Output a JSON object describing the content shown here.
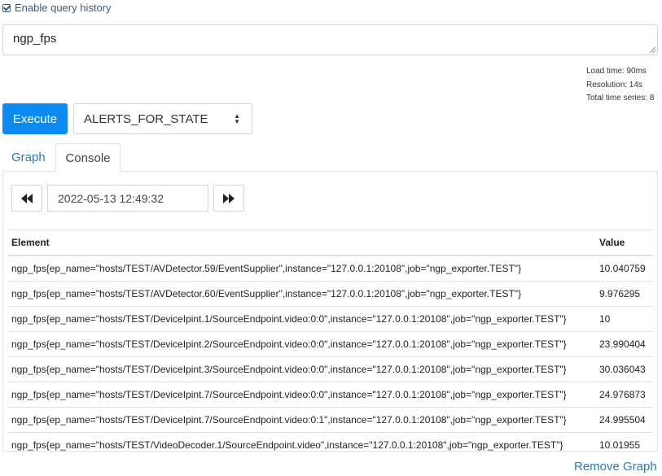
{
  "query_history": {
    "label": "Enable query history",
    "checked": true
  },
  "expression": "ngp_fps",
  "stats": {
    "load_time": "Load time: 90ms",
    "resolution": "Resolution: 14s",
    "total_series": "Total time series: 8"
  },
  "execute_label": "Execute",
  "metric_select": {
    "selected": "ALERTS_FOR_STATE"
  },
  "tabs": {
    "graph": "Graph",
    "console": "Console",
    "active": "console"
  },
  "console": {
    "eval_time": "2022-05-13 12:49:32",
    "columns": [
      "Element",
      "Value"
    ],
    "rows": [
      {
        "element": "ngp_fps{ep_name=\"hosts/TEST/AVDetector.59/EventSupplier\",instance=\"127.0.0.1:20108\",job=\"ngp_exporter.TEST\"}",
        "value": "10.040759"
      },
      {
        "element": "ngp_fps{ep_name=\"hosts/TEST/AVDetector.60/EventSupplier\",instance=\"127.0.0.1:20108\",job=\"ngp_exporter.TEST\"}",
        "value": "9.976295"
      },
      {
        "element": "ngp_fps{ep_name=\"hosts/TEST/DeviceIpint.1/SourceEndpoint.video:0:0\",instance=\"127.0.0.1:20108\",job=\"ngp_exporter.TEST\"}",
        "value": "10"
      },
      {
        "element": "ngp_fps{ep_name=\"hosts/TEST/DeviceIpint.2/SourceEndpoint.video:0:0\",instance=\"127.0.0.1:20108\",job=\"ngp_exporter.TEST\"}",
        "value": "23.990404"
      },
      {
        "element": "ngp_fps{ep_name=\"hosts/TEST/DeviceIpint.3/SourceEndpoint.video:0:0\",instance=\"127.0.0.1:20108\",job=\"ngp_exporter.TEST\"}",
        "value": "30.036043"
      },
      {
        "element": "ngp_fps{ep_name=\"hosts/TEST/DeviceIpint.7/SourceEndpoint.video:0:0\",instance=\"127.0.0.1:20108\",job=\"ngp_exporter.TEST\"}",
        "value": "24.976873"
      },
      {
        "element": "ngp_fps{ep_name=\"hosts/TEST/DeviceIpint.7/SourceEndpoint.video:0:1\",instance=\"127.0.0.1:20108\",job=\"ngp_exporter.TEST\"}",
        "value": "24.995504"
      },
      {
        "element": "ngp_fps{ep_name=\"hosts/TEST/VideoDecoder.1/SourceEndpoint.video\",instance=\"127.0.0.1:20108\",job=\"ngp_exporter.TEST\"}",
        "value": "10.01955"
      }
    ]
  },
  "remove_graph": "Remove Graph",
  "colors": {
    "execute_bg": "#0d8bf2",
    "link": "#2a7ab8"
  },
  "icons": {
    "checkbox": "check-square-icon",
    "select": "updown-caret-icon",
    "back": "backward-icon",
    "forward": "forward-icon"
  }
}
